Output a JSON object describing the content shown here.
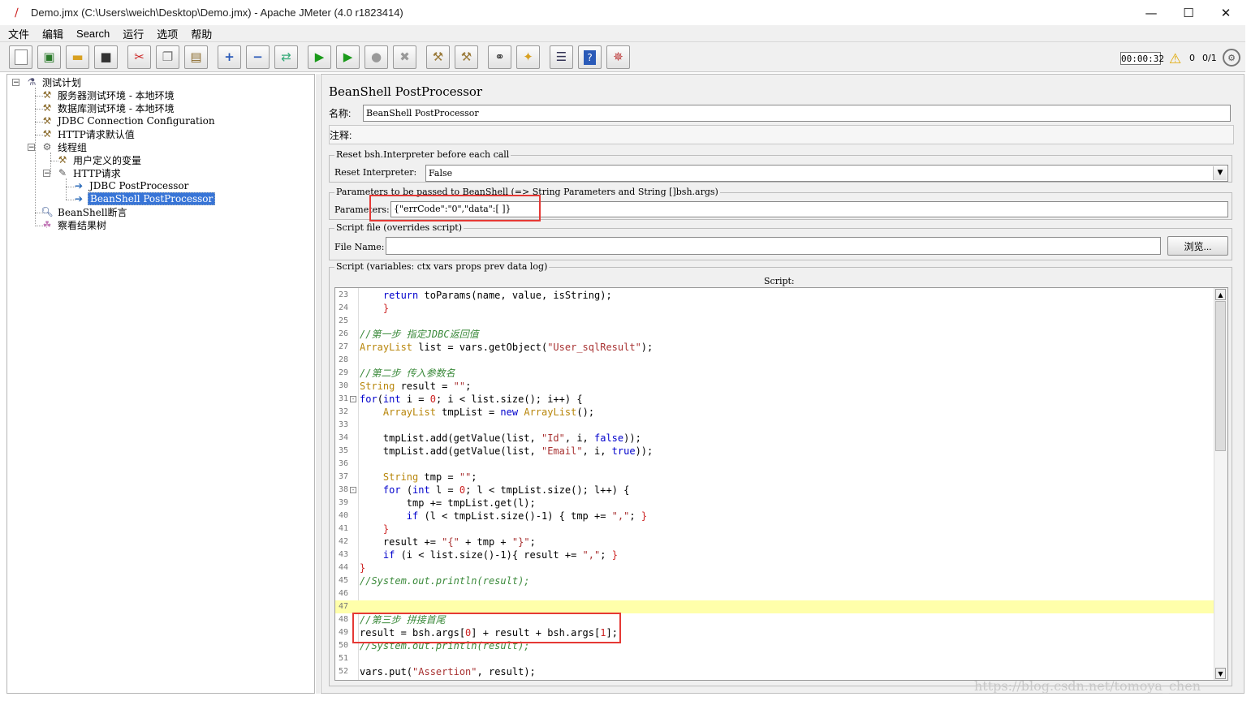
{
  "window": {
    "title": "Demo.jmx (C:\\Users\\weich\\Desktop\\Demo.jmx) - Apache JMeter (4.0 r1823414)",
    "minimize": "—",
    "maximize": "☐",
    "close": "✕"
  },
  "menu": [
    "文件",
    "编辑",
    "Search",
    "运行",
    "选项",
    "帮助"
  ],
  "toolbar": {
    "timer": "00:00:32",
    "warning_count": "0",
    "threads": "0/1"
  },
  "tree": [
    {
      "label": "测试计划",
      "icon": "test-plan-icon"
    },
    {
      "label": "服务器测试环境 - 本地环境",
      "icon": "config-icon"
    },
    {
      "label": "数据库测试环境 - 本地环境",
      "icon": "config-icon"
    },
    {
      "label": "JDBC Connection Configuration",
      "icon": "config-icon"
    },
    {
      "label": "HTTP请求默认值",
      "icon": "config-icon"
    },
    {
      "label": "线程组",
      "icon": "gear-icon"
    },
    {
      "label": "用户定义的变量",
      "icon": "config-icon"
    },
    {
      "label": "HTTP请求",
      "icon": "sampler-icon"
    },
    {
      "label": "JDBC PostProcessor",
      "icon": "postprocessor-icon"
    },
    {
      "label": "BeanShell PostProcessor",
      "icon": "postprocessor-icon"
    },
    {
      "label": "BeanShell断言",
      "icon": "assertion-icon"
    },
    {
      "label": "察看结果树",
      "icon": "listener-icon"
    }
  ],
  "panel": {
    "title": "BeanShell PostProcessor",
    "name_label": "名称:",
    "name_value": "BeanShell PostProcessor",
    "comment_label": "注释:",
    "reset_legend": "Reset bsh.Interpreter before each call",
    "reset_label": "Reset Interpreter:",
    "reset_value": "False",
    "params_legend": "Parameters to be passed to BeanShell (=> String Parameters and String []bsh.args)",
    "params_label": "Parameters:",
    "params_value": "{\"errCode\":\"0\",\"data\":[ ]}",
    "file_legend": "Script file (overrides script)",
    "file_label": "File Name:",
    "browse_label": "浏览...",
    "script_legend": "Script (variables: ctx vars props prev data log)",
    "script_header": "Script:"
  },
  "code_lines": [
    {
      "n": "23",
      "fold": "",
      "html": "    <span class=\"kw\">return</span> toParams(name, value, isString);"
    },
    {
      "n": "24",
      "fold": "",
      "html": "    <span class=\"nm\">}</span>"
    },
    {
      "n": "25",
      "fold": "",
      "html": ""
    },
    {
      "n": "26",
      "fold": "",
      "html": "<span class=\"cm\">//第一步 指定JDBC返回值</span>"
    },
    {
      "n": "27",
      "fold": "",
      "html": "<span class=\"ty\">ArrayList</span> list = vars.getObject(<span class=\"st\">\"User_sqlResult\"</span>);"
    },
    {
      "n": "28",
      "fold": "",
      "html": ""
    },
    {
      "n": "29",
      "fold": "",
      "html": "<span class=\"cm\">//第二步 传入参数名</span>"
    },
    {
      "n": "30",
      "fold": "",
      "html": "<span class=\"ty\">String</span> result = <span class=\"st\">\"\"</span>;"
    },
    {
      "n": "31",
      "fold": "-",
      "html": "<span class=\"kw\">for</span>(<span class=\"kw\">int</span> i = <span class=\"nm\">0</span>; i &lt; list.size(); i++) {"
    },
    {
      "n": "32",
      "fold": "",
      "html": "    <span class=\"ty\">ArrayList</span> tmpList = <span class=\"kw\">new</span> <span class=\"ty\">ArrayList</span>();"
    },
    {
      "n": "33",
      "fold": "",
      "html": ""
    },
    {
      "n": "34",
      "fold": "",
      "html": "    tmpList.add(getValue(list, <span class=\"st\">\"Id\"</span>, i, <span class=\"kw\">false</span>));"
    },
    {
      "n": "35",
      "fold": "",
      "html": "    tmpList.add(getValue(list, <span class=\"st\">\"Email\"</span>, i, <span class=\"kw\">true</span>));"
    },
    {
      "n": "36",
      "fold": "",
      "html": ""
    },
    {
      "n": "37",
      "fold": "",
      "html": "    <span class=\"ty\">String</span> tmp = <span class=\"st\">\"\"</span>;"
    },
    {
      "n": "38",
      "fold": "-",
      "html": "    <span class=\"kw\">for</span> (<span class=\"kw\">int</span> l = <span class=\"nm\">0</span>; l &lt; tmpList.size(); l++) {"
    },
    {
      "n": "39",
      "fold": "",
      "html": "        tmp += tmpList.get(l);"
    },
    {
      "n": "40",
      "fold": "",
      "html": "        <span class=\"kw\">if</span> (l &lt; tmpList.size()-1) { tmp += <span class=\"st\">\",\"</span>; <span class=\"nm\">}</span>"
    },
    {
      "n": "41",
      "fold": "",
      "html": "    <span class=\"nm\">}</span>"
    },
    {
      "n": "42",
      "fold": "",
      "html": "    result += <span class=\"st\">\"{\"</span> + tmp + <span class=\"st\">\"}\"</span>;"
    },
    {
      "n": "43",
      "fold": "",
      "html": "    <span class=\"kw\">if</span> (i &lt; list.size()-1){ result += <span class=\"st\">\",\"</span>; <span class=\"nm\">}</span>"
    },
    {
      "n": "44",
      "fold": "",
      "html": "<span class=\"nm\">}</span>"
    },
    {
      "n": "45",
      "fold": "",
      "html": "<span class=\"cm\">//System.out.println(result);</span>"
    },
    {
      "n": "46",
      "fold": "",
      "html": ""
    },
    {
      "n": "47",
      "fold": "",
      "html": "",
      "hl": true
    },
    {
      "n": "48",
      "fold": "",
      "html": "<span class=\"cm\">//第三步 拼接首尾</span>"
    },
    {
      "n": "49",
      "fold": "",
      "html": "result = bsh.args[<span class=\"nm\">0</span>] + result + bsh.args[<span class=\"nm\">1</span>];"
    },
    {
      "n": "50",
      "fold": "",
      "html": "<span class=\"cm\">//System.out.println(result);</span>"
    },
    {
      "n": "51",
      "fold": "",
      "html": ""
    },
    {
      "n": "52",
      "fold": "",
      "html": "vars.put(<span class=\"st\">\"Assertion\"</span>, result);"
    }
  ],
  "watermark": "https://blog.csdn.net/tomoya_chen"
}
